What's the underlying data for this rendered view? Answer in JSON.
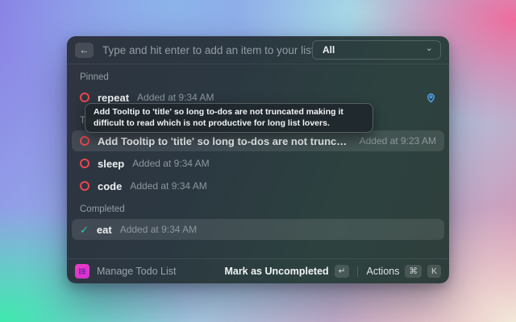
{
  "topbar": {
    "search_placeholder": "Type and hit enter to add an item to your list...",
    "filter_value": "All"
  },
  "icons": {
    "back": "←",
    "chevron_down": "⌄",
    "check": "✓",
    "return_key": "↵",
    "command_key": "⌘",
    "k_key": "K"
  },
  "tooltip": {
    "text": "Add Tooltip to 'title' so long to-dos are not truncated making it difficult to read which is not productive for long list lovers."
  },
  "sections": [
    {
      "title": "Pinned",
      "items": [
        {
          "title": "repeat",
          "subtitle": "Added at 9:34 AM",
          "state": "todo",
          "pinned": true
        }
      ]
    },
    {
      "title": "Todo",
      "items": [
        {
          "title": "Add Tooltip to 'title' so long to-dos are not truncated making it difficult to read which is not productive for long list lovers.",
          "subtitle": "Added at 9:23 AM",
          "state": "todo",
          "hovered": true
        },
        {
          "title": "sleep",
          "subtitle": "Added at 9:34 AM",
          "state": "todo"
        },
        {
          "title": "code",
          "subtitle": "Added at 9:34 AM",
          "state": "todo"
        }
      ]
    },
    {
      "title": "Completed",
      "items": [
        {
          "title": "eat",
          "subtitle": "Added at 9:34 AM",
          "state": "completed",
          "selected": true
        }
      ]
    }
  ],
  "footer": {
    "app_name": "Manage Todo List",
    "primary_action": "Mark as Uncompleted",
    "actions_label": "Actions"
  },
  "colors": {
    "todo_ring": "#e8474f",
    "check": "#2bc7b5",
    "pin": "#4da3f5",
    "brand_pink": "#f03ec4"
  }
}
